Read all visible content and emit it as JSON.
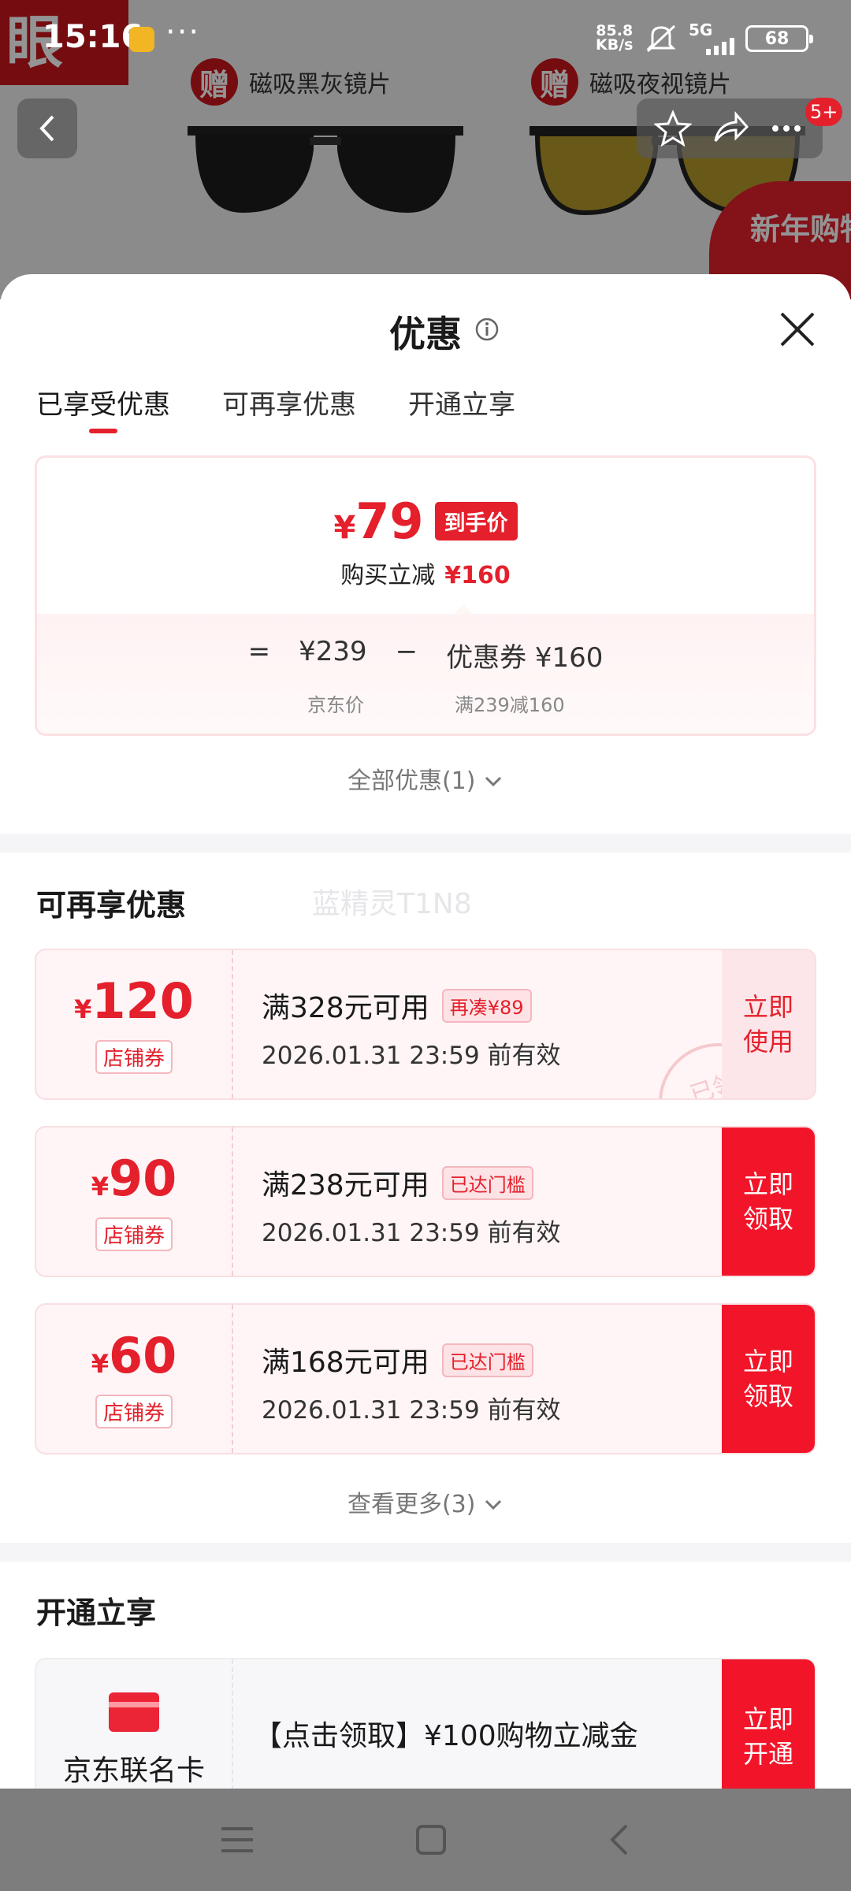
{
  "status_bar": {
    "time": "15:16",
    "net_speed_value": "85.8",
    "net_speed_unit": "KB/s",
    "signal_label": "5G",
    "battery": "68"
  },
  "background": {
    "logo_text": "眼",
    "gift_badge": "赠",
    "gift_1": "磁吸黑灰镜片",
    "gift_2": "磁吸夜视镜片",
    "notification_count": "5+",
    "promo_text": "新年购物季"
  },
  "sheet": {
    "title": "优惠",
    "tabs": [
      {
        "label": "已享受优惠",
        "active": true
      },
      {
        "label": "可再享优惠",
        "active": false
      },
      {
        "label": "开通立享",
        "active": false
      }
    ],
    "price_card": {
      "currency": "¥",
      "final_price": "79",
      "final_tag": "到手价",
      "reduce_label": "购买立减",
      "reduce_value": "¥160",
      "equals": "=",
      "jd_price": "¥239",
      "minus": "−",
      "coupon_label": "优惠券 ¥160",
      "jd_price_caption": "京东价",
      "coupon_caption": "满239减160"
    },
    "all_offers": "全部优惠(1)",
    "more_section": {
      "title": "可再享优惠",
      "watermark": "蓝精灵T1N8",
      "coupons": [
        {
          "currency": "¥",
          "amount": "120",
          "type": "店铺券",
          "condition": "满328元可用",
          "tag": "再凑¥89",
          "validity": "2026.01.31 23:59 前有效",
          "action": "立即使用",
          "stamp": "已领"
        },
        {
          "currency": "¥",
          "amount": "90",
          "type": "店铺券",
          "condition": "满238元可用",
          "tag": "已达门槛",
          "validity": "2026.01.31 23:59 前有效",
          "action": "立即领取"
        },
        {
          "currency": "¥",
          "amount": "60",
          "type": "店铺券",
          "condition": "满168元可用",
          "tag": "已达门槛",
          "validity": "2026.01.31 23:59 前有效",
          "action": "立即领取"
        }
      ],
      "see_more": "查看更多(3)"
    },
    "open_section": {
      "title": "开通立享",
      "card": {
        "name": "京东联名卡",
        "description": "【点击领取】¥100购物立减金",
        "action": "立即开通"
      }
    }
  },
  "colors": {
    "accent": "#e4202c",
    "claim_button": "#f2152a",
    "use_button_bg": "#fde6e9",
    "coupon_bg": "#fff5f6"
  }
}
